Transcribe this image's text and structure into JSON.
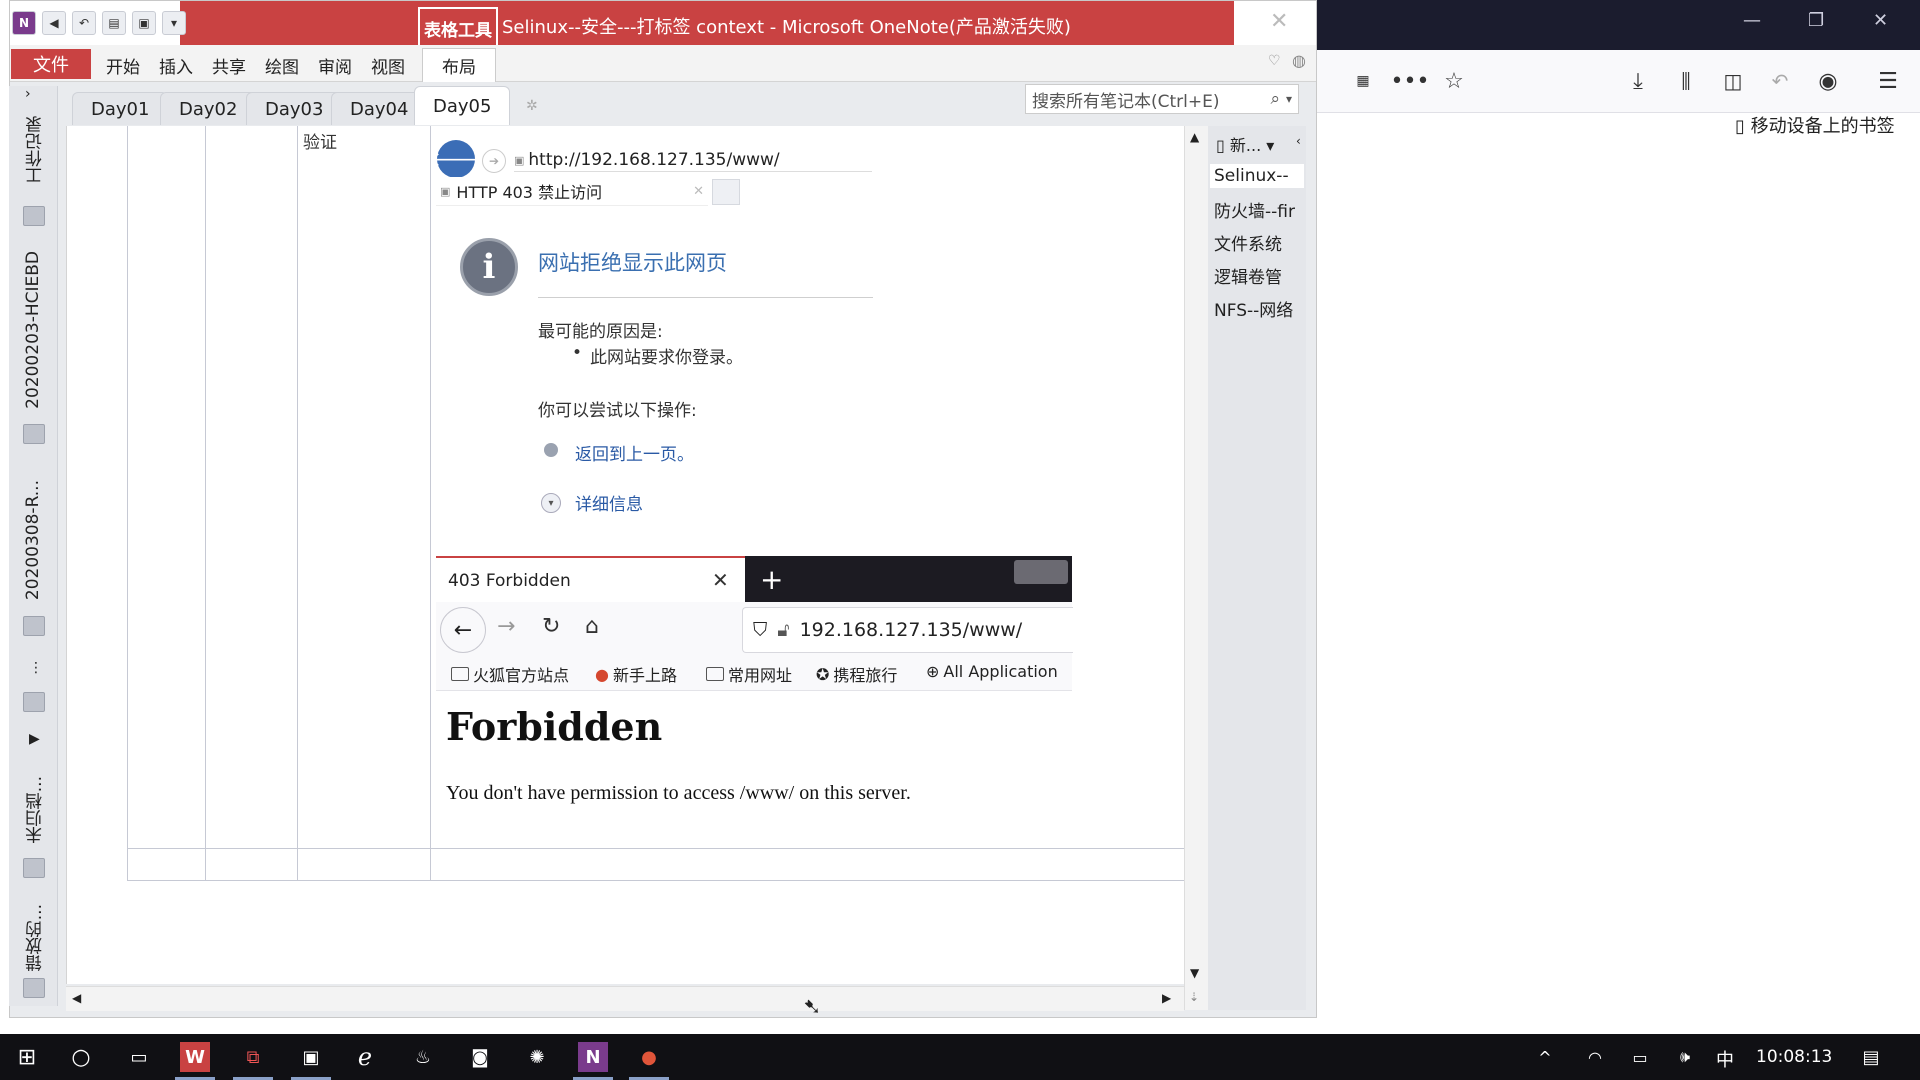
{
  "onenote": {
    "title": "Selinux--安全---打标签  context - Microsoft OneNote(产品激活失败)",
    "table_tools_label": "表格工具",
    "ribbon_tabs": [
      "文件",
      "开始",
      "插入",
      "共享",
      "绘图",
      "审阅",
      "视图",
      "布局"
    ],
    "section_tabs": [
      "Day01",
      "Day02",
      "Day03",
      "Day04",
      "Day05"
    ],
    "search_placeholder": "搜索所有笔记本(Ctrl+E)",
    "notebooks": [
      "工作记录",
      "20200203-HCIEBD",
      "20200308-R...",
      "未归档...",
      "错放的..."
    ],
    "table_cell_text": "验证",
    "pages": {
      "new_label": "新...",
      "items": [
        "Selinux--",
        "防火墙--fir",
        "文件系统",
        "逻辑卷管",
        "NFS--网络"
      ]
    }
  },
  "ie_screenshot": {
    "url": "http://192.168.127.135/www/",
    "tab_title": "HTTP 403 禁止访问",
    "heading": "网站拒绝显示此网页",
    "reason_title": "最可能的原因是:",
    "reason_item": "此网站要求你登录。",
    "try_title": "你可以尝试以下操作:",
    "action_back": "返回到上一页。",
    "action_details": "详细信息"
  },
  "firefox_screenshot": {
    "tab_title": "403 Forbidden",
    "url": "192.168.127.135/www/",
    "bookmarks": [
      "火狐官方站点",
      "新手上路",
      "常用网址",
      "携程旅行",
      "All Application"
    ],
    "heading": "Forbidden",
    "message": "You don't have permission to access /www/ on this server."
  },
  "firefox_bg": {
    "mobile_bookmarks": "移动设备上的书签"
  },
  "taskbar": {
    "ime": "中",
    "clock": "10:08:13"
  },
  "colors": {
    "onenote_accent": "#c94242",
    "ie_heading": "#3a6fb0",
    "ff_dark": "#1c1b22",
    "taskbar": "#101014"
  }
}
